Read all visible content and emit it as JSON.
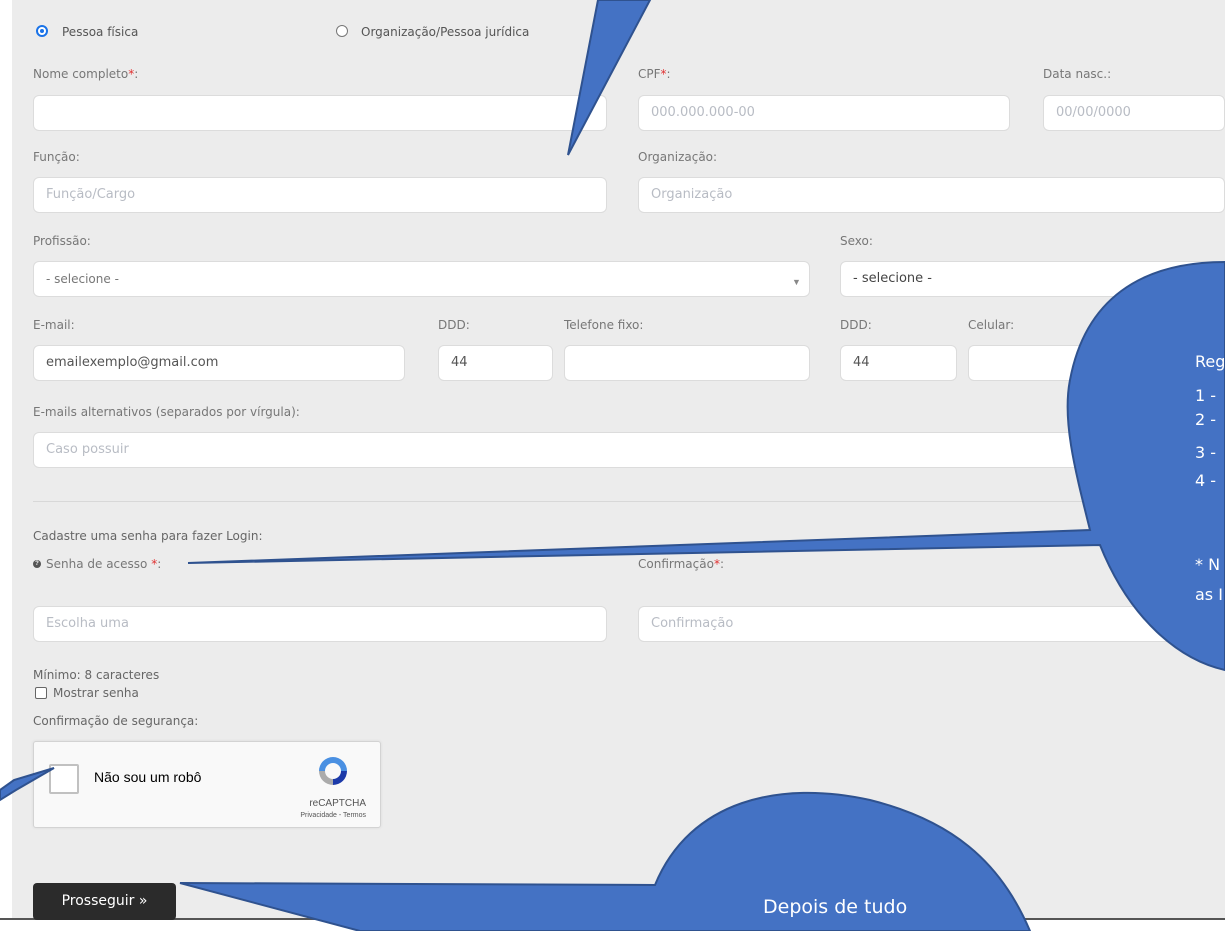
{
  "person_type": {
    "option_fisica": "Pessoa física",
    "option_juridica": "Organização/Pessoa jurídica",
    "selected": "Pessoa física"
  },
  "form": {
    "nome": {
      "label": "Nome completo",
      "required": "*",
      "colon": ":",
      "value": ""
    },
    "cpf": {
      "label": "CPF",
      "required": "*",
      "colon": ":",
      "placeholder": "000.000.000-00"
    },
    "data_nasc": {
      "label": "Data nasc.:",
      "placeholder": "00/00/0000"
    },
    "funcao": {
      "label": "Função:",
      "placeholder": "Função/Cargo"
    },
    "organizacao": {
      "label": "Organização:",
      "placeholder": "Organização"
    },
    "profissao": {
      "label": "Profissão:",
      "selected": "- selecione -"
    },
    "sexo": {
      "label": "Sexo:",
      "selected": "- selecione -"
    },
    "email": {
      "label": "E-mail:",
      "value": "emailexemplo@gmail.com"
    },
    "ddd_fixo": {
      "label": "DDD:",
      "value": "44"
    },
    "telefone_fixo": {
      "label": "Telefone fixo:",
      "value": ""
    },
    "ddd_celular": {
      "label": "DDD:",
      "value": "44"
    },
    "celular": {
      "label": "Celular:",
      "value": ""
    },
    "emails_alt": {
      "label": "E-mails alternativos (separados por vírgula):",
      "placeholder": "Caso possuir"
    }
  },
  "password_section": {
    "heading": "Cadastre uma senha para fazer Login:",
    "senha": {
      "label": "Senha de acesso ",
      "required": "*",
      "colon": ":",
      "placeholder": "Escolha uma"
    },
    "confirmacao": {
      "label": "Confirmação",
      "required": "*",
      "colon": ":",
      "placeholder": "Confirmação"
    },
    "hint": "Mínimo: 8 caracteres",
    "show_password": "Mostrar senha"
  },
  "security": {
    "label": "Confirmação de segurança:",
    "recaptcha_text": "Não sou um robô",
    "recaptcha_brand": "reCAPTCHA",
    "recaptcha_links": "Privacidade - Termos"
  },
  "submit_label": "Prosseguir »",
  "annotations": {
    "rules_lines": [
      "Reg",
      "1 -",
      "2 -",
      "3 -",
      "4 -",
      "",
      "* N",
      "as I"
    ],
    "bottom_bubble": "Depois de tudo",
    "bubble_color": "#4472c4"
  }
}
